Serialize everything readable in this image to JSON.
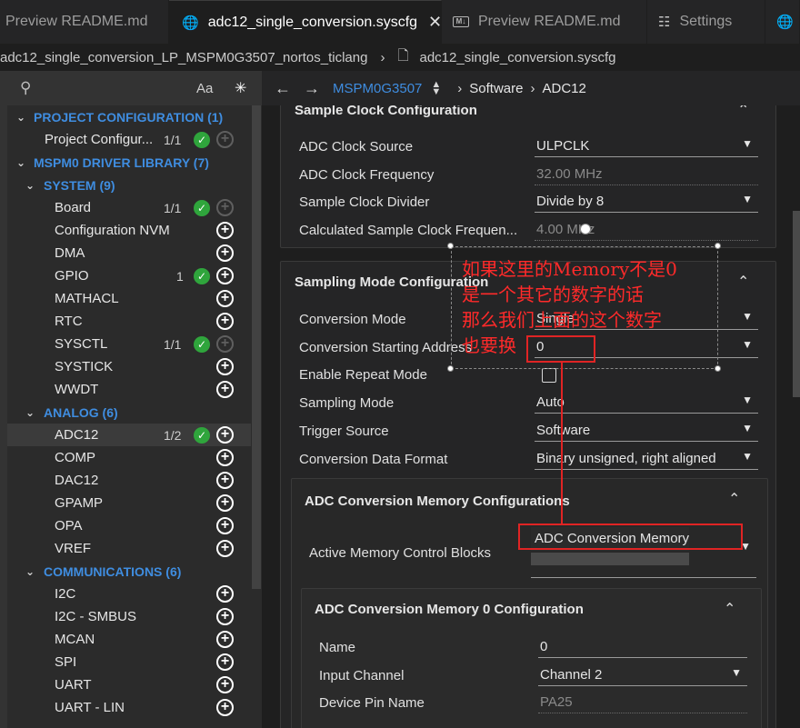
{
  "tabs": [
    {
      "label": "Preview README.md",
      "icon": "markdown-icon",
      "active": false
    },
    {
      "label": "adc12_single_conversion.syscfg",
      "icon": "globe-icon",
      "active": true,
      "close": "✕"
    },
    {
      "label": "Preview README.md",
      "icon": "markdown-icon",
      "active": false
    },
    {
      "label": "Settings",
      "icon": "settings-icon",
      "active": false
    }
  ],
  "breadcrumb": {
    "project": "adc12_single_conversion_LP_MSPM0G3507_nortos_ticlang",
    "file": "adc12_single_conversion.syscfg"
  },
  "sidebar": {
    "font_toggle": "Aa",
    "tree": [
      {
        "label": "PROJECT CONFIGURATION (1)",
        "level": 0,
        "section": true
      },
      {
        "label": "Project Configur...",
        "level": 1,
        "count": "1/1",
        "ok": true,
        "add": "dim"
      },
      {
        "label": "MSPM0 DRIVER LIBRARY (7)",
        "level": 0,
        "section": true
      },
      {
        "label": "SYSTEM (9)",
        "level": 1,
        "section": true
      },
      {
        "label": "Board",
        "level": 2,
        "count": "1/1",
        "ok": true,
        "add": "dim"
      },
      {
        "label": "Configuration NVM",
        "level": 2,
        "add": "on"
      },
      {
        "label": "DMA",
        "level": 2,
        "add": "on"
      },
      {
        "label": "GPIO",
        "level": 2,
        "count": "1",
        "ok": true,
        "add": "on"
      },
      {
        "label": "MATHACL",
        "level": 2,
        "add": "on"
      },
      {
        "label": "RTC",
        "level": 2,
        "add": "on"
      },
      {
        "label": "SYSCTL",
        "level": 2,
        "count": "1/1",
        "ok": true,
        "add": "dim"
      },
      {
        "label": "SYSTICK",
        "level": 2,
        "add": "on"
      },
      {
        "label": "WWDT",
        "level": 2,
        "add": "on"
      },
      {
        "label": "ANALOG (6)",
        "level": 1,
        "section": true
      },
      {
        "label": "ADC12",
        "level": 2,
        "count": "1/2",
        "ok": true,
        "add": "on",
        "selected": true
      },
      {
        "label": "COMP",
        "level": 2,
        "add": "on"
      },
      {
        "label": "DAC12",
        "level": 2,
        "add": "on"
      },
      {
        "label": "GPAMP",
        "level": 2,
        "add": "on"
      },
      {
        "label": "OPA",
        "level": 2,
        "add": "on"
      },
      {
        "label": "VREF",
        "level": 2,
        "add": "on"
      },
      {
        "label": "COMMUNICATIONS (6)",
        "level": 1,
        "section": true
      },
      {
        "label": "I2C",
        "level": 2,
        "add": "on"
      },
      {
        "label": "I2C - SMBUS",
        "level": 2,
        "add": "on"
      },
      {
        "label": "MCAN",
        "level": 2,
        "add": "on"
      },
      {
        "label": "SPI",
        "level": 2,
        "add": "on"
      },
      {
        "label": "UART",
        "level": 2,
        "add": "on"
      },
      {
        "label": "UART - LIN",
        "level": 2,
        "add": "on"
      }
    ]
  },
  "nav": {
    "device": "MSPM0G3507",
    "crumbs": [
      "Software",
      "ADC12"
    ]
  },
  "sample_clock": {
    "title": "Sample Clock Configuration",
    "fields": [
      {
        "label": "ADC Clock Source",
        "value": "ULPCLK",
        "kind": "dropdown"
      },
      {
        "label": "ADC Clock Frequency",
        "value": "32.00 MHz",
        "kind": "readonly"
      },
      {
        "label": "Sample Clock Divider",
        "value": "Divide by 8",
        "kind": "dropdown"
      },
      {
        "label": "Calculated Sample Clock Frequen...",
        "value": "4.00 MHz",
        "kind": "readonly"
      }
    ]
  },
  "sampling_mode": {
    "title": "Sampling Mode Configuration",
    "fields": [
      {
        "label": "Conversion Mode",
        "value": "Single",
        "kind": "dropdown"
      },
      {
        "label": "Conversion Starting Address",
        "value": "0",
        "kind": "dropdown"
      },
      {
        "label": "Enable Repeat Mode",
        "value": "",
        "kind": "checkbox"
      },
      {
        "label": "Sampling Mode",
        "value": "Auto",
        "kind": "dropdown"
      },
      {
        "label": "Trigger Source",
        "value": "Software",
        "kind": "dropdown"
      },
      {
        "label": "Conversion Data Format",
        "value": "Binary unsigned, right aligned",
        "kind": "dropdown"
      }
    ]
  },
  "memory_configs": {
    "title": "ADC Conversion Memory Configurations",
    "active_label": "Active Memory Control Blocks",
    "active_value": "ADC Conversion Memory (",
    "mem0": {
      "title": "ADC Conversion Memory 0 Configuration",
      "fields": [
        {
          "label": "Name",
          "value": "0",
          "kind": "text"
        },
        {
          "label": "Input Channel",
          "value": "Channel 2",
          "kind": "dropdown"
        },
        {
          "label": "Device Pin Name",
          "value": "PA25",
          "kind": "readonly"
        }
      ]
    }
  },
  "annotation": {
    "lines": [
      "如果这里的Memory不是0",
      "是一个其它的数字的话",
      "那么我们上面的这个数字",
      "也要换"
    ]
  },
  "colors": {
    "accent": "#3f8de0",
    "ok": "#2fa53c",
    "annotation": "#e02424"
  }
}
